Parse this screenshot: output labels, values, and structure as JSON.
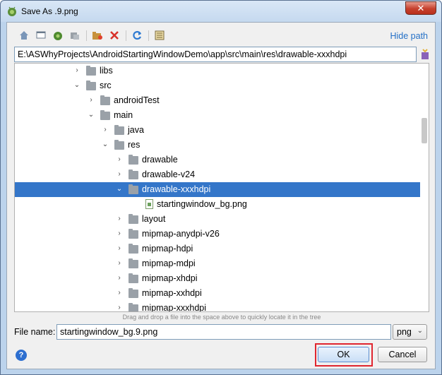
{
  "window": {
    "title": "Save As .9.png",
    "close_label": "✕"
  },
  "toolbar": {
    "buttons": [
      {
        "name": "home-icon",
        "glyph": "⌂"
      },
      {
        "name": "desktop-icon",
        "glyph": "▭"
      },
      {
        "name": "project-icon",
        "glyph": "●"
      },
      {
        "name": "module-icon",
        "glyph": "▪"
      },
      {
        "name": "new-folder-icon",
        "glyph": "▣"
      },
      {
        "name": "delete-icon",
        "glyph": "✕"
      },
      {
        "name": "refresh-icon",
        "glyph": "⟳"
      },
      {
        "name": "show-hidden-icon",
        "glyph": "▦"
      }
    ],
    "hide_path_label": "Hide path"
  },
  "path": {
    "value": "E:\\ASWhyProjects\\AndroidStartingWindowDemo\\app\\src\\main\\res\\drawable-xxxhdpi"
  },
  "tree": {
    "rows": [
      {
        "label": "libs",
        "arrow": "›",
        "type": "folder",
        "selected": false
      },
      {
        "label": "src",
        "arrow": "⌄",
        "type": "folder",
        "selected": false
      },
      {
        "label": "androidTest",
        "arrow": "›",
        "type": "folder",
        "selected": false
      },
      {
        "label": "main",
        "arrow": "⌄",
        "type": "folder",
        "selected": false
      },
      {
        "label": "java",
        "arrow": "›",
        "type": "folder",
        "selected": false
      },
      {
        "label": "res",
        "arrow": "⌄",
        "type": "folder",
        "selected": false
      },
      {
        "label": "drawable",
        "arrow": "›",
        "type": "folder",
        "selected": false
      },
      {
        "label": "drawable-v24",
        "arrow": "›",
        "type": "folder",
        "selected": false
      },
      {
        "label": "drawable-xxxhdpi",
        "arrow": "⌄",
        "type": "folder",
        "selected": true
      },
      {
        "label": "startingwindow_bg.png",
        "arrow": "",
        "type": "file",
        "selected": false
      },
      {
        "label": "layout",
        "arrow": "›",
        "type": "folder",
        "selected": false
      },
      {
        "label": "mipmap-anydpi-v26",
        "arrow": "›",
        "type": "folder",
        "selected": false
      },
      {
        "label": "mipmap-hdpi",
        "arrow": "›",
        "type": "folder",
        "selected": false
      },
      {
        "label": "mipmap-mdpi",
        "arrow": "›",
        "type": "folder",
        "selected": false
      },
      {
        "label": "mipmap-xhdpi",
        "arrow": "›",
        "type": "folder",
        "selected": false
      },
      {
        "label": "mipmap-xxhdpi",
        "arrow": "›",
        "type": "folder",
        "selected": false
      },
      {
        "label": "mipmap-xxxhdpi",
        "arrow": "›",
        "type": "folder",
        "selected": false
      }
    ]
  },
  "hint": "Drag and drop a file into the space above to quickly locate it in the tree",
  "file_name": {
    "label": "File name:",
    "value": "startingwindow_bg.9.png"
  },
  "extension": {
    "selected": "png"
  },
  "buttons": {
    "help": "?",
    "ok": "OK",
    "cancel": "Cancel"
  },
  "colors": {
    "selection": "#3476c9",
    "link": "#2470c7",
    "highlight": "#e0262f"
  }
}
